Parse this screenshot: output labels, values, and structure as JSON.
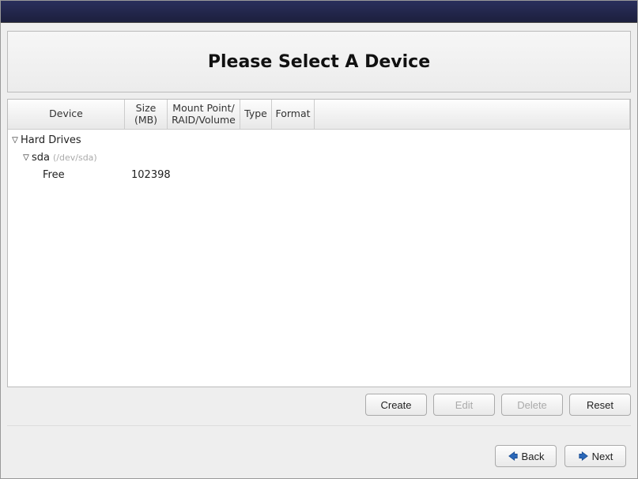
{
  "header": {
    "title": "Please Select A Device"
  },
  "columns": {
    "device": "Device",
    "size": "Size (MB)",
    "mount": "Mount Point/ RAID/Volume",
    "type": "Type",
    "format": "Format"
  },
  "tree": {
    "root_label": "Hard Drives",
    "disk": {
      "name": "sda",
      "path": "(/dev/sda)"
    },
    "free": {
      "label": "Free",
      "size": "102398"
    }
  },
  "buttons": {
    "create": "Create",
    "edit": "Edit",
    "delete": "Delete",
    "reset": "Reset",
    "back": "Back",
    "next": "Next"
  }
}
